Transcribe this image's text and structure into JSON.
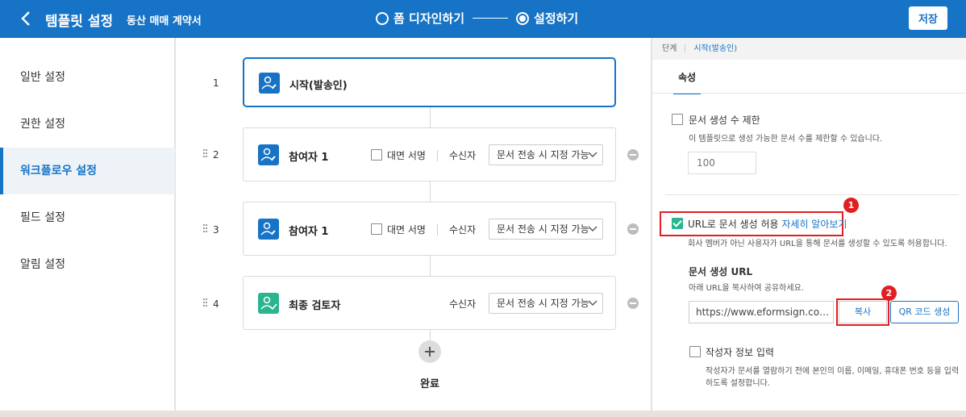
{
  "header": {
    "title": "템플릿 설정",
    "document_name": "동산 매매 계약서",
    "steps": [
      {
        "label": "폼 디자인하기",
        "active": false
      },
      {
        "label": "설정하기",
        "active": true
      }
    ],
    "save_label": "저장"
  },
  "sidebar": {
    "items": [
      {
        "label": "일반 설정",
        "active": false
      },
      {
        "label": "권한 설정",
        "active": false
      },
      {
        "label": "워크플로우 설정",
        "active": true
      },
      {
        "label": "필드 설정",
        "active": false
      },
      {
        "label": "알림 설정",
        "active": false
      }
    ]
  },
  "workflow": {
    "steps": [
      {
        "number": "1",
        "label": "시작(발송인)"
      },
      {
        "number": "2",
        "label": "참여자 1",
        "face_to_face_label": "대면 서명",
        "recipient_label": "수신자",
        "recipient_value": "문서 전송 시 지정 가능"
      },
      {
        "number": "3",
        "label": "참여자 1",
        "face_to_face_label": "대면 서명",
        "recipient_label": "수신자",
        "recipient_value": "문서 전송 시 지정 가능"
      },
      {
        "number": "4",
        "label": "최종 검토자",
        "recipient_label": "수신자",
        "recipient_value": "문서 전송 시 지정 가능"
      }
    ],
    "done_label": "완료"
  },
  "panel": {
    "breadcrumb_stage": "단계",
    "breadcrumb_current": "시작(발송인)",
    "tab_label": "속성",
    "limit": {
      "label": "문서 생성 수 제한",
      "description": "이 템플릿으로 생성 가능한 문서 수를 제한할 수 있습니다.",
      "placeholder": "100"
    },
    "url_allow": {
      "label": "URL로 문서 생성 허용",
      "link": "자세히 알아보기",
      "description": "회사 멤버가 아닌 사용자가 URL을 통해 문서를 생성할 수 있도록 허용합니다.",
      "url_title": "문서 생성 URL",
      "url_hint": "아래 URL을 복사하여 공유하세요.",
      "url_value": "https://www.eformsign.co…",
      "copy_label": "복사",
      "qr_label": "QR 코드 생성"
    },
    "author_info": {
      "label": "작성자 정보 입력",
      "description_line1": "작성자가 문서를 열람하기 전에 본인의 이름, 이메일, 휴대폰 번호 등을 입력",
      "description_line2": "하도록 설정합니다."
    },
    "badges": [
      "1",
      "2"
    ]
  },
  "colors": {
    "primary": "#1673c6",
    "accent_green": "#2ab58f",
    "annotation_red": "#e02020"
  }
}
